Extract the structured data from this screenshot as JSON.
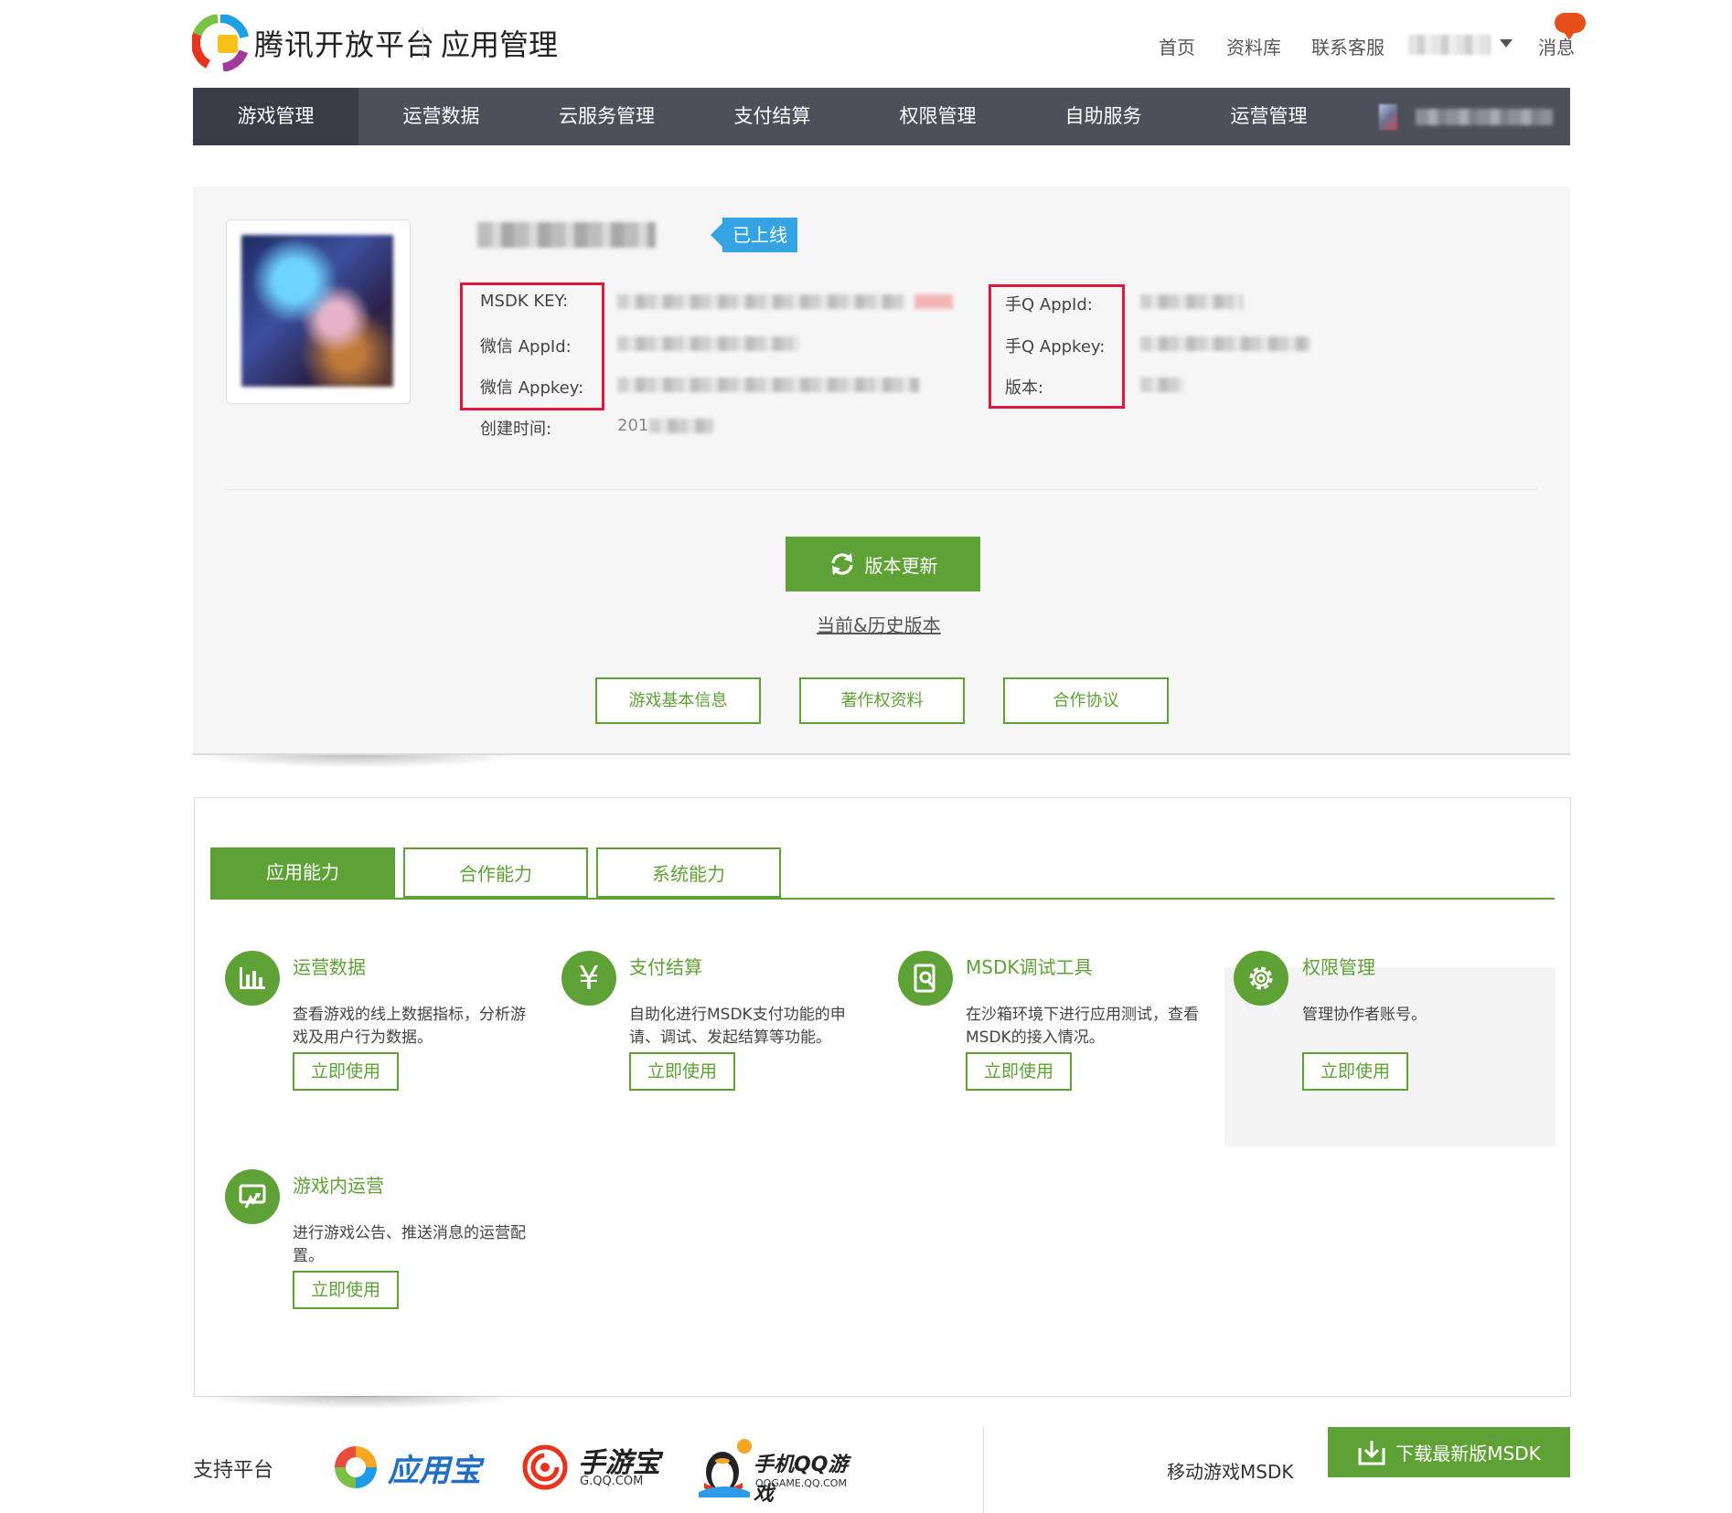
{
  "header": {
    "brand": "腾讯开放平台",
    "section": "应用管理",
    "links": [
      "首页",
      "资料库",
      "联系客服"
    ],
    "messages_label": "消息"
  },
  "nav": {
    "items": [
      "游戏管理",
      "运营数据",
      "云服务管理",
      "支付结算",
      "权限管理",
      "自助服务",
      "运营管理"
    ],
    "active_index": 0
  },
  "app": {
    "status": "已上线",
    "labels": {
      "msdk_key": "MSDK KEY:",
      "wx_appid": "微信 AppId:",
      "wx_appkey": "微信 Appkey:",
      "created": "创建时间:",
      "qq_appid": "手Q AppId:",
      "qq_appkey": "手Q Appkey:",
      "version": "版本:"
    },
    "created_prefix": "201"
  },
  "actions": {
    "update": "版本更新",
    "history": "当前&历史版本",
    "buttons": [
      "游戏基本信息",
      "著作权资料",
      "合作协议"
    ]
  },
  "capabilities": {
    "tabs": [
      "应用能力",
      "合作能力",
      "系统能力"
    ],
    "active_tab": 0,
    "use_label": "立即使用",
    "cards": [
      {
        "title": "运营数据",
        "desc": "查看游戏的线上数据指标，分析游戏及用户行为数据。",
        "icon": "bar-chart-icon"
      },
      {
        "title": "支付结算",
        "desc": "自助化进行MSDK支付功能的申请、调试、发起结算等功能。",
        "icon": "yen-icon"
      },
      {
        "title": "MSDK调试工具",
        "desc": "在沙箱环境下进行应用测试，查看MSDK的接入情况。",
        "icon": "debug-tool-icon"
      },
      {
        "title": "权限管理",
        "desc": "管理协作者账号。",
        "icon": "gear-icon"
      },
      {
        "title": "游戏内运营",
        "desc": "进行游戏公告、推送消息的运营配置。",
        "icon": "in-game-ops-icon"
      }
    ]
  },
  "footer": {
    "support_label": "支持平台",
    "platforms": {
      "yyb": "应用宝",
      "syb": "手游宝",
      "syb_url": "G.QQ.COM",
      "qqgame": "手机QQ游戏",
      "qqgame_url": "QQGAME.QQ.COM"
    },
    "msdk_label": "移动游戏MSDK",
    "download": "下载最新版MSDK"
  },
  "colors": {
    "accent": "#5ea236",
    "nav_bg": "#4d4f5a",
    "status_blue": "#35a2e2",
    "highlight_red": "#e0183e",
    "badge_orange": "#e8501b"
  }
}
